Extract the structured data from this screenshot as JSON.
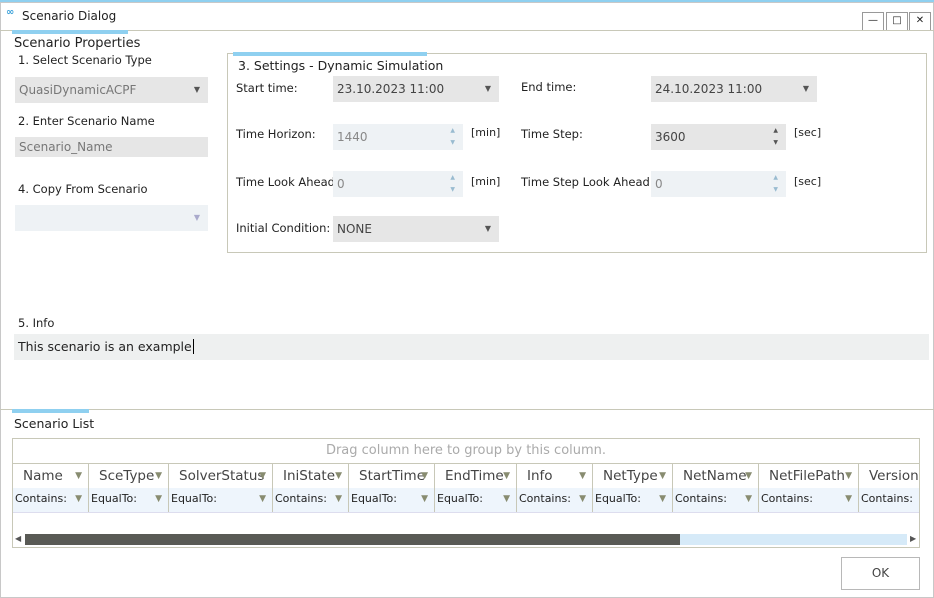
{
  "window": {
    "title": "Scenario Dialog",
    "icon": "sam-logo-icon",
    "controls": [
      "minimize",
      "maximize",
      "close"
    ]
  },
  "properties": {
    "title": "Scenario Properties",
    "select_type_label": "1. Select Scenario Type",
    "scenario_type": "QuasiDynamicACPF",
    "name_label": "2. Enter Scenario Name",
    "name_value": "Scenario_Name",
    "copy_label": "4. Copy From Scenario",
    "copy_value": ""
  },
  "settings": {
    "title": "3. Settings - Dynamic Simulation",
    "start_time_label": "Start time:",
    "start_time": "23.10.2023 11:00",
    "end_time_label": "End time:",
    "end_time": "24.10.2023 11:00",
    "horizon_label": "Time Horizon:",
    "horizon": "1440",
    "horizon_unit": "[min]",
    "step_label": "Time Step:",
    "step": "3600",
    "step_unit": "[sec]",
    "lookahead_label": "Time Look Ahead:",
    "lookahead": "0",
    "lookahead_unit": "[min]",
    "step_lookahead_label": "Time Step Look Ahead:",
    "step_lookahead": "0",
    "step_lookahead_unit": "[sec]",
    "initial_label": "Initial Condition:",
    "initial": "NONE"
  },
  "info": {
    "label": "5. Info",
    "value": "This scenario is an example"
  },
  "list": {
    "title": "Scenario List",
    "group_hint": "Drag column here to group by this column.",
    "columns": [
      {
        "name": "Name",
        "filter": "Contains:"
      },
      {
        "name": "SceType",
        "filter": "EqualTo:"
      },
      {
        "name": "SolverStatus",
        "filter": "EqualTo:"
      },
      {
        "name": "IniState",
        "filter": "Contains:"
      },
      {
        "name": "StartTime",
        "filter": "EqualTo:"
      },
      {
        "name": "EndTime",
        "filter": "EqualTo:"
      },
      {
        "name": "Info",
        "filter": "Contains:"
      },
      {
        "name": "NetType",
        "filter": "EqualTo:"
      },
      {
        "name": "NetName",
        "filter": "Contains:"
      },
      {
        "name": "NetFilePath",
        "filter": "Contains:"
      },
      {
        "name": "Version",
        "filter": "Contains:"
      }
    ],
    "scroll_position_percent": 0
  },
  "ok_label": "OK"
}
